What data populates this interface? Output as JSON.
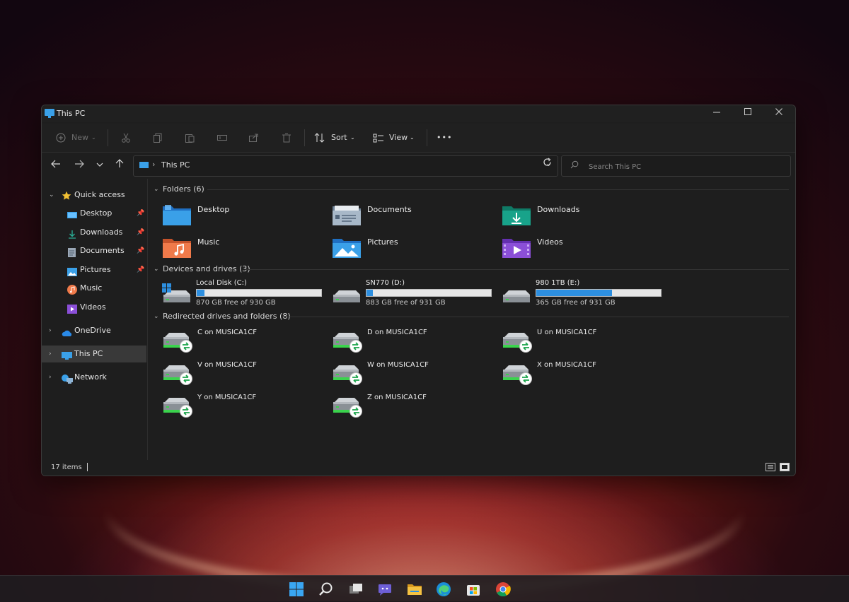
{
  "window": {
    "title": "This PC"
  },
  "toolbar": {
    "new_label": "New",
    "sort_label": "Sort",
    "view_label": "View",
    "more_label": "•••"
  },
  "address": {
    "path_label": "This PC"
  },
  "search": {
    "placeholder": "Search This PC",
    "value": ""
  },
  "sidebar": {
    "quick_access": "Quick access",
    "quick_items": [
      {
        "label": "Desktop",
        "icon": "desktop-icon"
      },
      {
        "label": "Downloads",
        "icon": "download-icon"
      },
      {
        "label": "Documents",
        "icon": "document-icon"
      },
      {
        "label": "Pictures",
        "icon": "pictures-icon"
      },
      {
        "label": "Music",
        "icon": "music-icon"
      },
      {
        "label": "Videos",
        "icon": "videos-icon"
      }
    ],
    "onedrive": "OneDrive",
    "this_pc": "This PC",
    "network": "Network"
  },
  "groups": {
    "folders": "Folders (6)",
    "devices": "Devices and drives (3)",
    "redirected": "Redirected drives and folders (8)"
  },
  "folders": [
    {
      "label": "Desktop",
      "icon": "desktop-folder-icon"
    },
    {
      "label": "Documents",
      "icon": "documents-folder-icon"
    },
    {
      "label": "Downloads",
      "icon": "downloads-folder-icon"
    },
    {
      "label": "Music",
      "icon": "music-folder-icon"
    },
    {
      "label": "Pictures",
      "icon": "pictures-folder-icon"
    },
    {
      "label": "Videos",
      "icon": "videos-folder-icon"
    }
  ],
  "drives": [
    {
      "name": "Local Disk (C:)",
      "free": "870 GB free of 930 GB",
      "used_fraction": 0.065,
      "windows": true
    },
    {
      "name": "SN770 (D:)",
      "free": "883 GB free of 931 GB",
      "used_fraction": 0.052,
      "windows": false
    },
    {
      "name": "980 1TB (E:)",
      "free": "365 GB free of 931 GB",
      "used_fraction": 0.608,
      "windows": false
    }
  ],
  "redirected": [
    "C on MUSICA1CF",
    "D on MUSICA1CF",
    "U on MUSICA1CF",
    "V on MUSICA1CF",
    "W on MUSICA1CF",
    "X on MUSICA1CF",
    "Y on MUSICA1CF",
    "Z on MUSICA1CF"
  ],
  "status": {
    "items_count": "17 items"
  },
  "colors": {
    "accent": "#2d8fe0",
    "folder_blue": "#3aa0e8",
    "downloads_teal": "#18a38a",
    "music_orange": "#f07a4a",
    "videos_purple": "#8b4fd8"
  },
  "taskbar": [
    "start-icon",
    "search-icon",
    "task-view-icon",
    "chat-icon",
    "file-explorer-icon",
    "edge-icon",
    "store-icon",
    "chrome-icon"
  ]
}
